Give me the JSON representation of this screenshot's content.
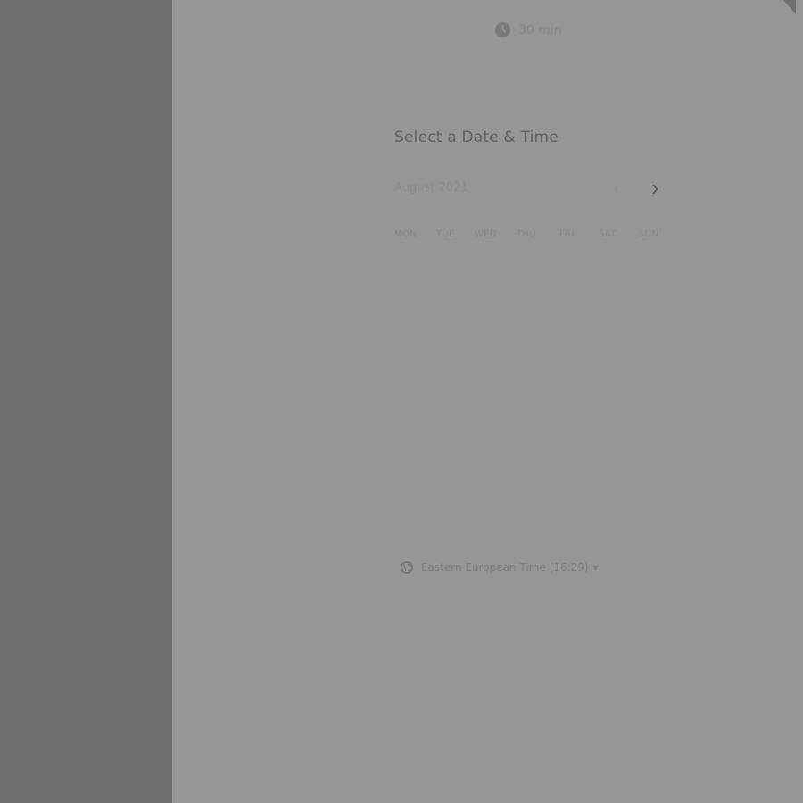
{
  "event": {
    "duration": "30 min",
    "duration_icon": "clock-icon"
  },
  "scheduler": {
    "title": "Select a Date & Time",
    "month": "August 2021",
    "prev_icon": "chevron-left-icon",
    "next_icon": "chevron-right-icon",
    "weekdays": [
      "MON",
      "TUE",
      "WED",
      "THU",
      "FRI",
      "SAT",
      "SUN"
    ]
  },
  "timezone": {
    "icon": "globe-icon",
    "label": "Eastern European Time (16:29)",
    "caret": "▼"
  },
  "colors": {
    "overlay_left": "#6e6e6e",
    "panel": "#969696"
  }
}
